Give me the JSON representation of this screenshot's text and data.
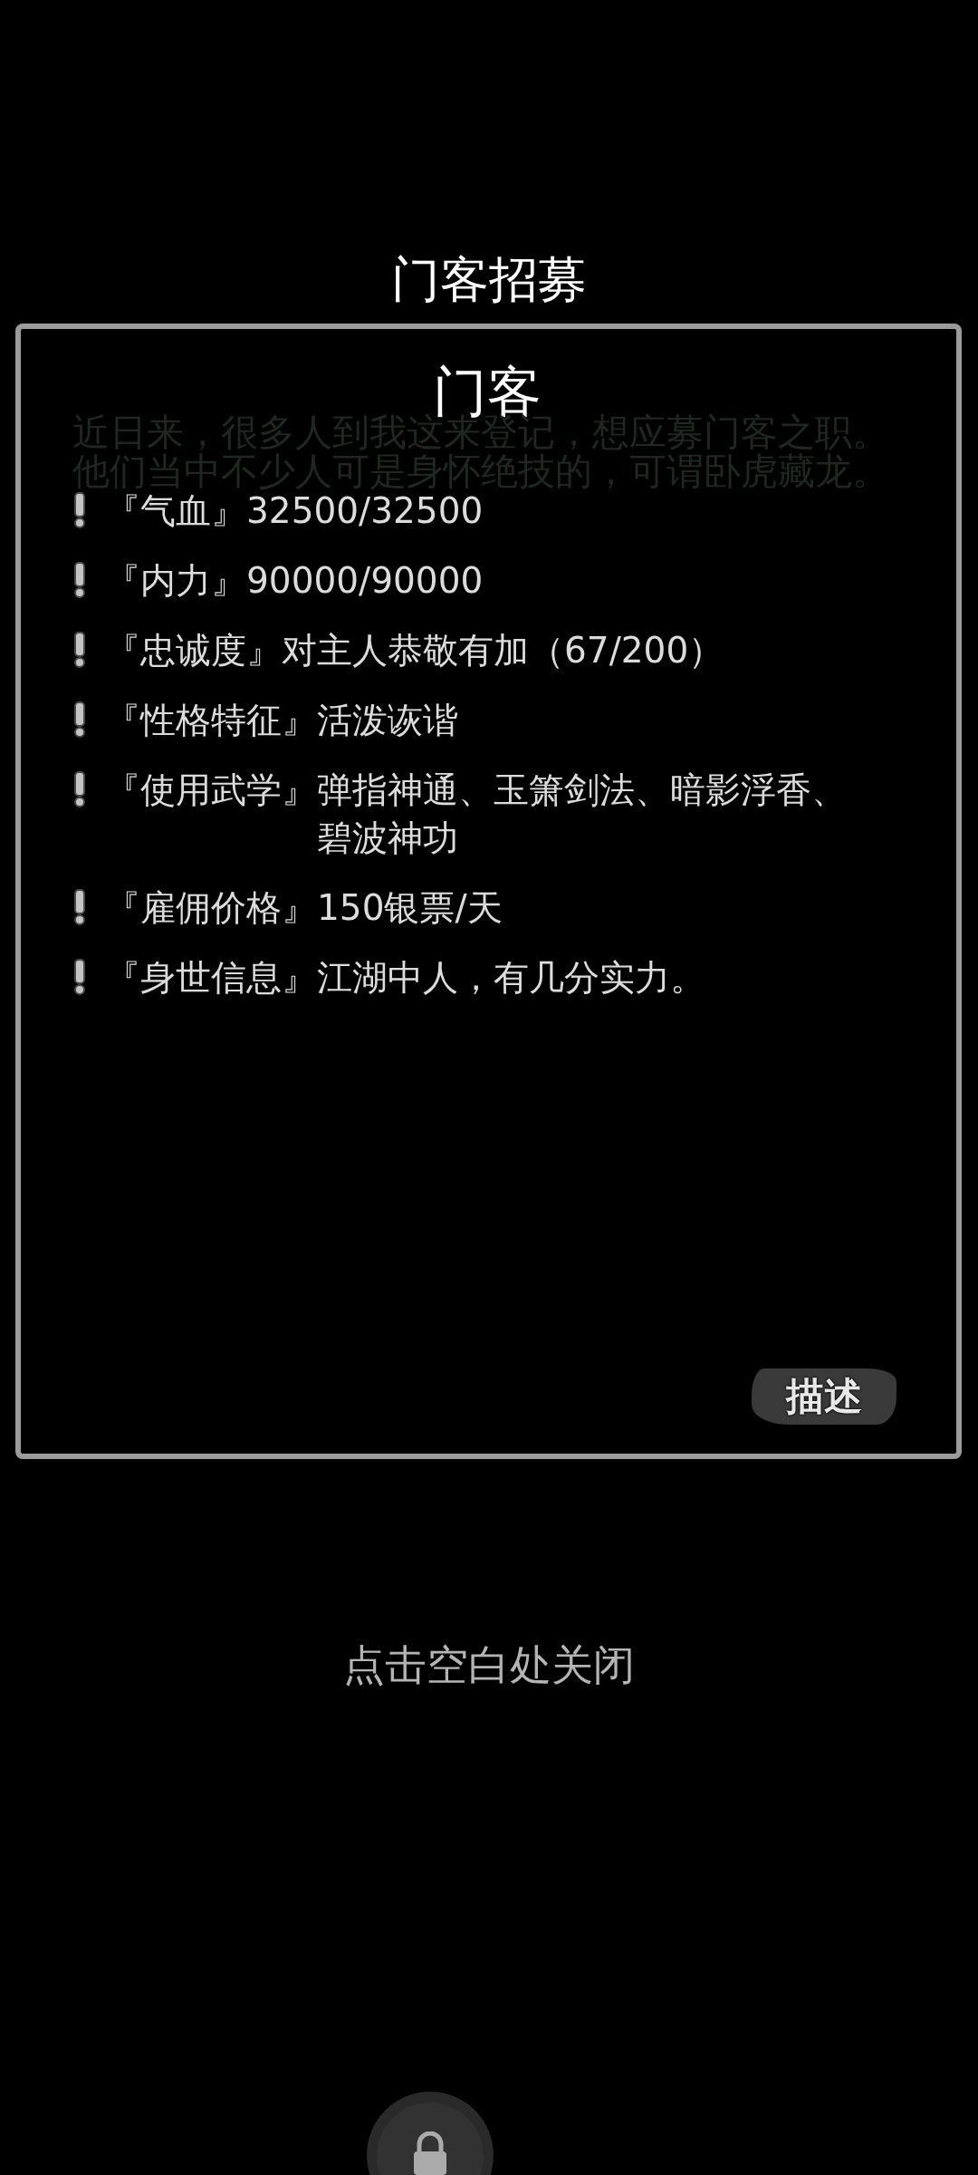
{
  "screen": {
    "title": "门客招募"
  },
  "background_page": {
    "intro_lines": [
      "近日来，很多人到我这来登记，想应募门客之职。",
      "他们当中不少人可是身怀绝技的，可谓卧虎藏龙。"
    ]
  },
  "dialog": {
    "title": "门客",
    "attributes": [
      {
        "label": "『气血』",
        "value": "32500/32500"
      },
      {
        "label": "『内力』",
        "value": "90000/90000"
      },
      {
        "label": "『忠诚度』",
        "value": "对主人恭敬有加（67/200）"
      },
      {
        "label": "『性格特征』",
        "value": "活泼诙谐"
      },
      {
        "label": "『使用武学』",
        "value": "弹指神通、玉箫剑法、暗影浮香、碧波神功"
      },
      {
        "label": "『雇佣价格』",
        "value": "150银票/天"
      },
      {
        "label": "『身世信息』",
        "value": "江湖中人，有几分实力。"
      }
    ],
    "describe_button": "描述"
  },
  "close_hint": "点击空白处关闭"
}
